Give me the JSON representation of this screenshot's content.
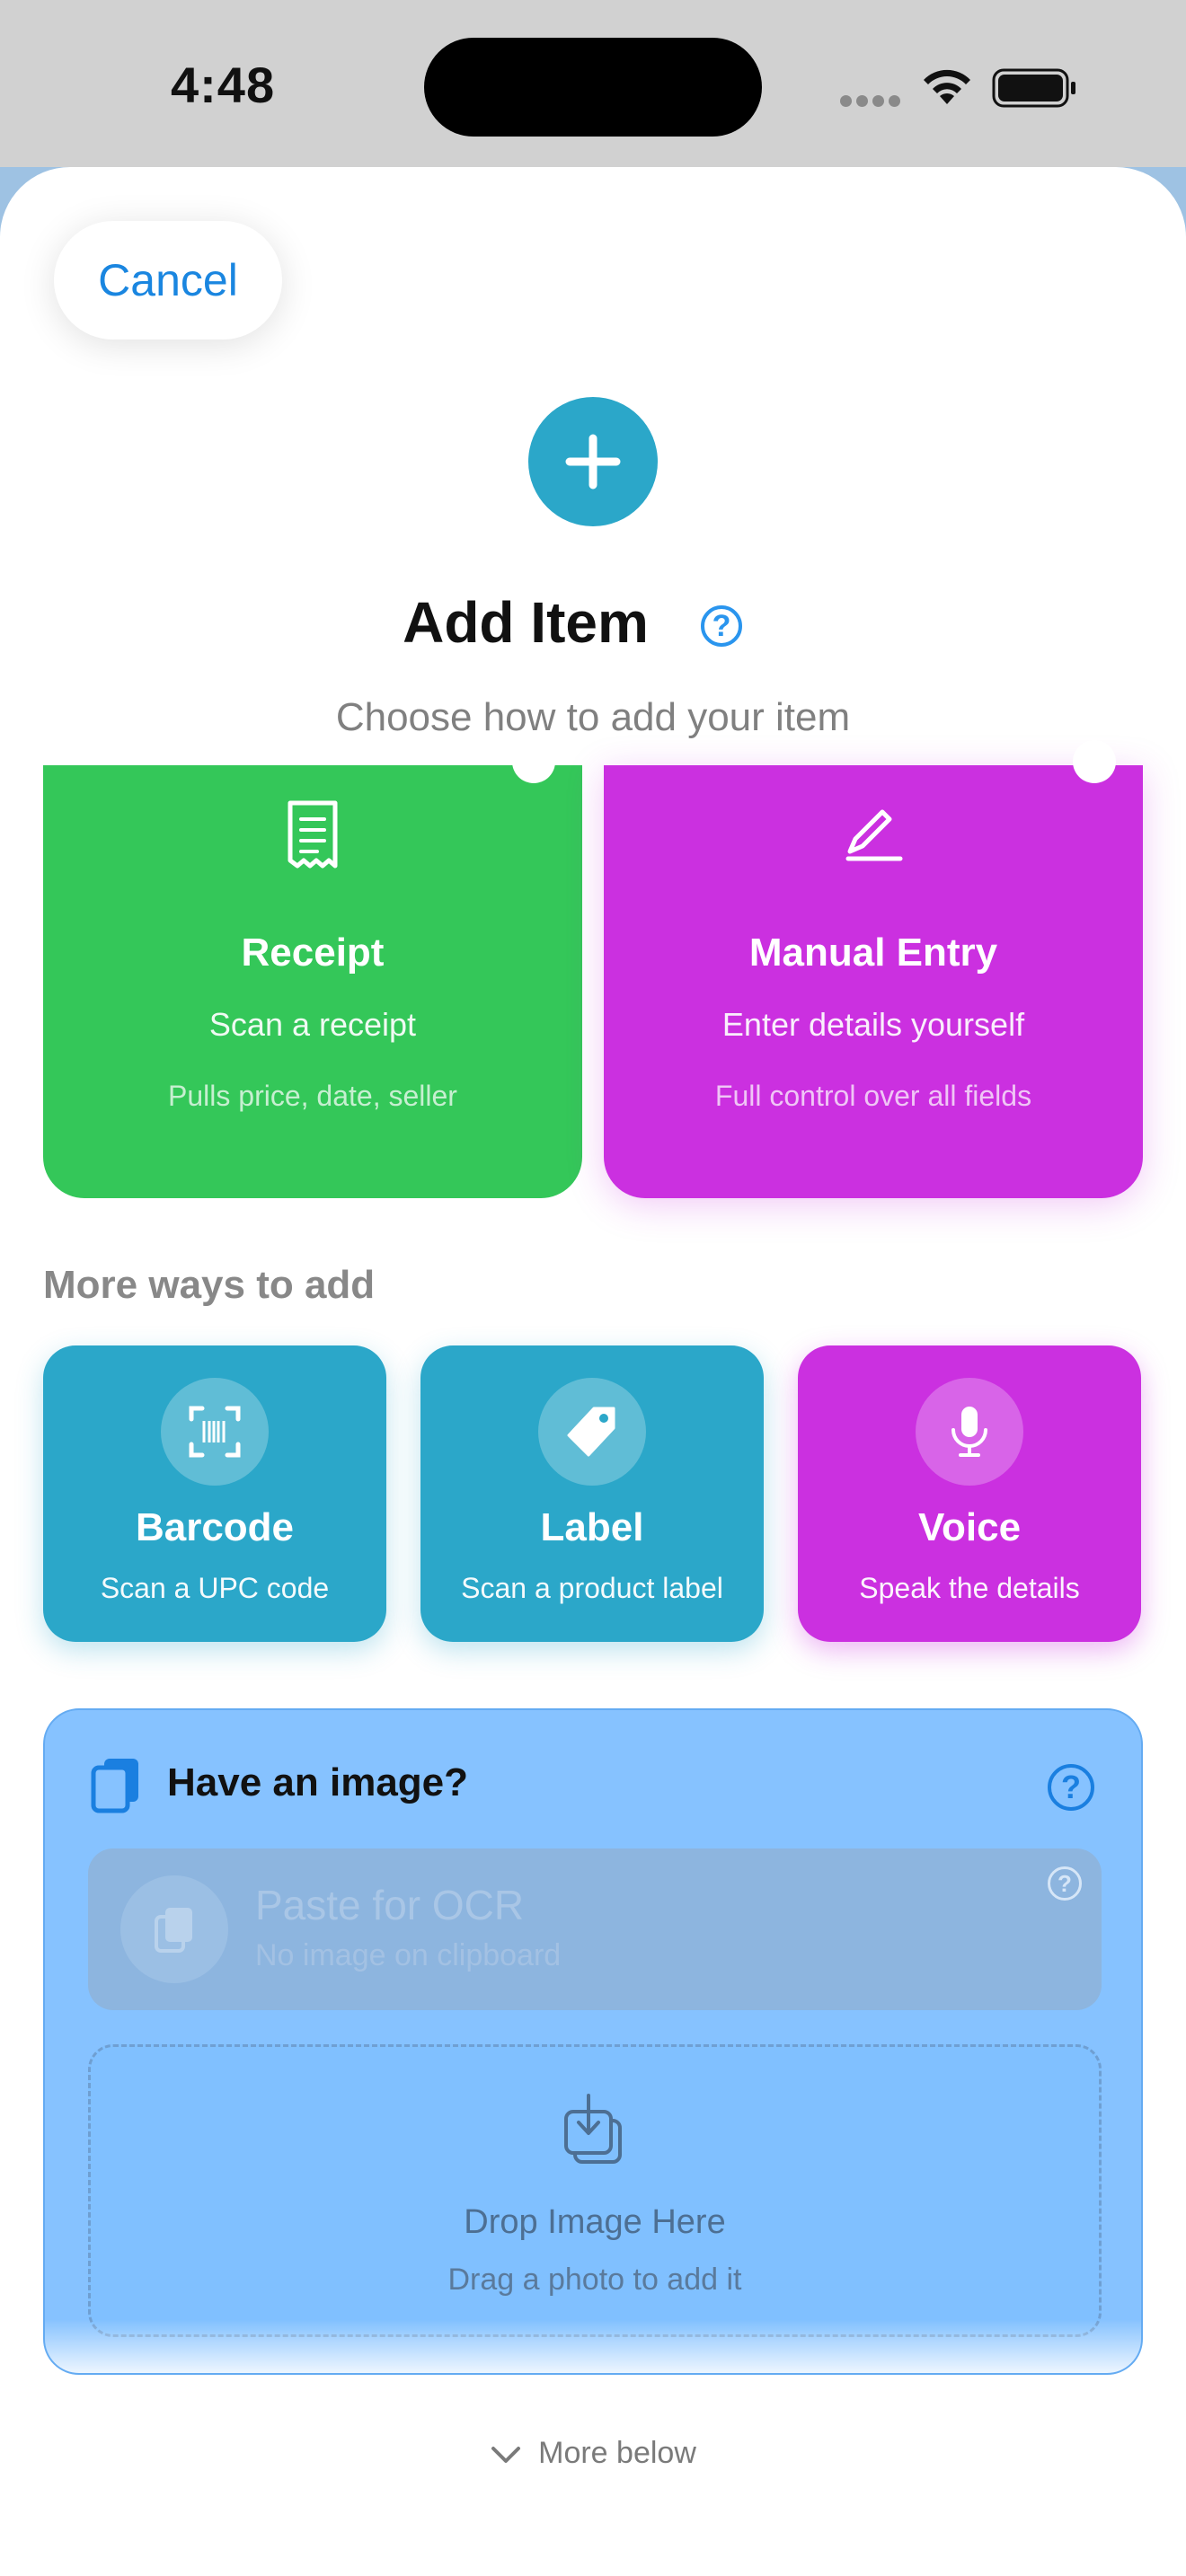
{
  "status_bar": {
    "time": "4:48"
  },
  "header": {
    "cancel_label": "Cancel",
    "title": "Add Item",
    "subtitle": "Choose how to add your item"
  },
  "primary_options": [
    {
      "name": "Receipt",
      "description": "Scan a receipt",
      "note": "Pulls price, date, seller",
      "icon": "receipt-icon",
      "color": "#34c759"
    },
    {
      "name": "Manual Entry",
      "description": "Enter details yourself",
      "note": "Full control over all fields",
      "icon": "pencil-icon",
      "color": "#cb30e0"
    }
  ],
  "more_section": {
    "label": "More ways to add"
  },
  "secondary_options": [
    {
      "name": "Barcode",
      "description": "Scan a UPC code",
      "icon": "barcode-scan-icon",
      "color": "#2ba7c9"
    },
    {
      "name": "Label",
      "description": "Scan a product label",
      "icon": "tag-icon",
      "color": "#2ba7c9"
    },
    {
      "name": "Voice",
      "description": "Speak the details",
      "icon": "microphone-icon",
      "color": "#cb30e0"
    }
  ],
  "image_section": {
    "title": "Have an image?",
    "paste": {
      "title": "Paste for OCR",
      "subtitle": "No image on clipboard",
      "enabled": false
    },
    "drop": {
      "title": "Drop Image Here",
      "subtitle": "Drag a photo to add it"
    }
  },
  "footer": {
    "more_label": "More below"
  }
}
